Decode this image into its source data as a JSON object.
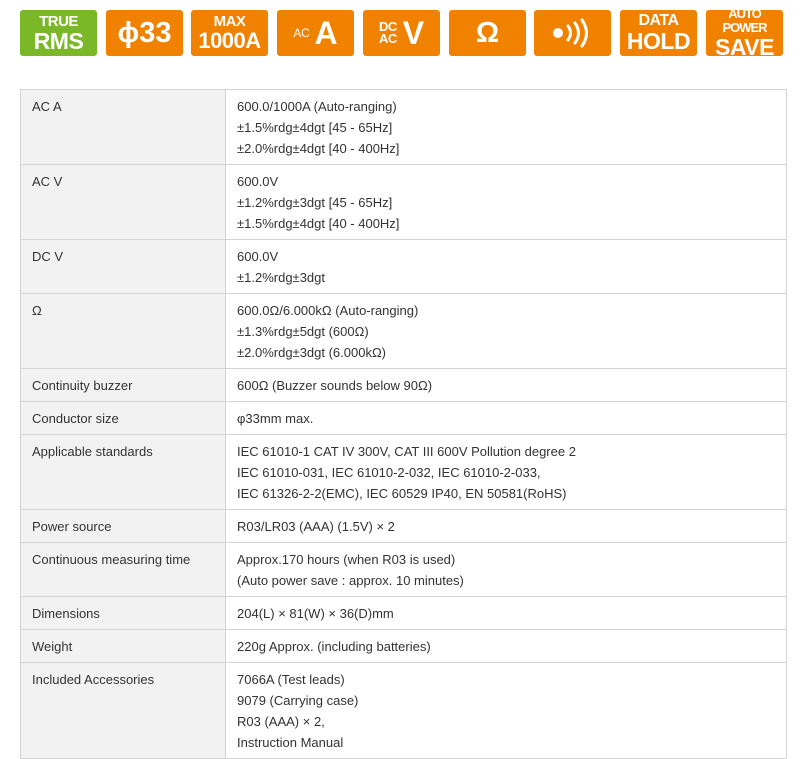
{
  "badges": {
    "true_rms": {
      "top": "TRUE",
      "bottom": "RMS"
    },
    "conductor": {
      "text": "ϕ33"
    },
    "max": {
      "top": "MAX",
      "bottom": "1000A"
    },
    "ac_a": {
      "small": "AC",
      "big": "A"
    },
    "dc_ac_v": {
      "small_top": "DC",
      "small_bottom": "AC",
      "big": "V"
    },
    "ohm": {
      "text": "Ω"
    },
    "buzzer": {
      "text": "●)))"
    },
    "data_hold": {
      "top": "DATA",
      "bottom": "HOLD"
    },
    "auto_power_save": {
      "top": "AUTO POWER",
      "bottom": "SAVE"
    }
  },
  "colors": {
    "green": "#7ab828",
    "orange": "#f08200",
    "label_bg": "#f2f2f2",
    "border": "#d4d4d4"
  },
  "spec_rows": [
    {
      "label": "AC A",
      "lines": [
        "600.0/1000A (Auto-ranging)",
        "±1.5%rdg±4dgt [45 - 65Hz]",
        "±2.0%rdg±4dgt [40 - 400Hz]"
      ]
    },
    {
      "label": "AC V",
      "lines": [
        "600.0V",
        "±1.2%rdg±3dgt [45 - 65Hz]",
        "±1.5%rdg±4dgt [40 - 400Hz]"
      ]
    },
    {
      "label": "DC V",
      "lines": [
        "600.0V",
        "±1.2%rdg±3dgt"
      ]
    },
    {
      "label": "Ω",
      "lines": [
        "600.0Ω/6.000kΩ (Auto-ranging)",
        "±1.3%rdg±5dgt (600Ω)",
        "±2.0%rdg±3dgt (6.000kΩ)"
      ]
    },
    {
      "label": "Continuity buzzer",
      "lines": [
        "600Ω (Buzzer sounds below 90Ω)"
      ]
    },
    {
      "label": "Conductor size",
      "lines": [
        "φ33mm max."
      ]
    },
    {
      "label": "Applicable standards",
      "lines": [
        "IEC 61010-1 CAT IV 300V, CAT III 600V Pollution degree 2",
        "IEC 61010-031, IEC 61010-2-032, IEC 61010-2-033,",
        "IEC 61326-2-2(EMC), IEC 60529 IP40, EN 50581(RoHS)"
      ]
    },
    {
      "label": "Power source",
      "lines": [
        "R03/LR03 (AAA) (1.5V) × 2"
      ]
    },
    {
      "label": "Continuous measuring time",
      "lines": [
        "Approx.170 hours (when R03 is used)",
        "(Auto power save : approx. 10 minutes)"
      ]
    },
    {
      "label": "Dimensions",
      "lines": [
        "204(L) × 81(W) × 36(D)mm"
      ]
    },
    {
      "label": "Weight",
      "lines": [
        "220g Approx. (including batteries)"
      ]
    },
    {
      "label": "Included Accessories",
      "lines": [
        "7066A (Test leads)",
        "9079 (Carrying case)",
        "R03 (AAA) × 2,",
        "Instruction Manual"
      ]
    }
  ]
}
